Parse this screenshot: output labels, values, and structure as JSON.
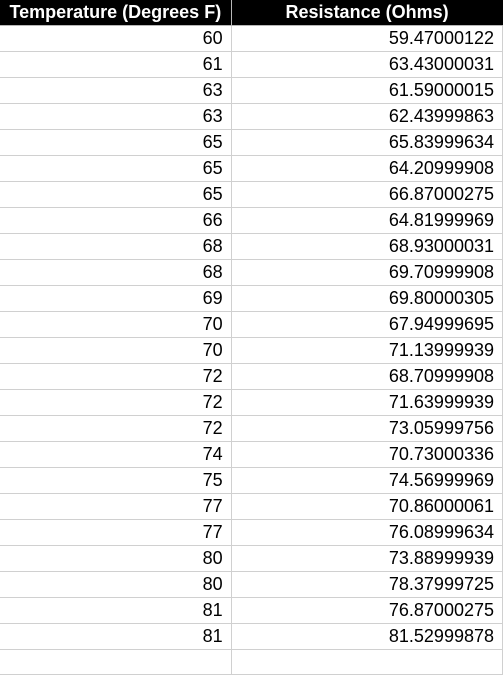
{
  "table": {
    "headers": {
      "temperature": "Temperature (Degrees F)",
      "resistance": "Resistance (Ohms)"
    },
    "rows": [
      {
        "temperature": "60",
        "resistance": "59.47000122"
      },
      {
        "temperature": "61",
        "resistance": "63.43000031"
      },
      {
        "temperature": "63",
        "resistance": "61.59000015"
      },
      {
        "temperature": "63",
        "resistance": "62.43999863"
      },
      {
        "temperature": "65",
        "resistance": "65.83999634"
      },
      {
        "temperature": "65",
        "resistance": "64.20999908"
      },
      {
        "temperature": "65",
        "resistance": "66.87000275"
      },
      {
        "temperature": "66",
        "resistance": "64.81999969"
      },
      {
        "temperature": "68",
        "resistance": "68.93000031"
      },
      {
        "temperature": "68",
        "resistance": "69.70999908"
      },
      {
        "temperature": "69",
        "resistance": "69.80000305"
      },
      {
        "temperature": "70",
        "resistance": "67.94999695"
      },
      {
        "temperature": "70",
        "resistance": "71.13999939"
      },
      {
        "temperature": "72",
        "resistance": "68.70999908"
      },
      {
        "temperature": "72",
        "resistance": "71.63999939"
      },
      {
        "temperature": "72",
        "resistance": "73.05999756"
      },
      {
        "temperature": "74",
        "resistance": "70.73000336"
      },
      {
        "temperature": "75",
        "resistance": "74.56999969"
      },
      {
        "temperature": "77",
        "resistance": "70.86000061"
      },
      {
        "temperature": "77",
        "resistance": "76.08999634"
      },
      {
        "temperature": "80",
        "resistance": "73.88999939"
      },
      {
        "temperature": "80",
        "resistance": "78.37999725"
      },
      {
        "temperature": "81",
        "resistance": "76.87000275"
      },
      {
        "temperature": "81",
        "resistance": "81.52999878"
      }
    ]
  }
}
